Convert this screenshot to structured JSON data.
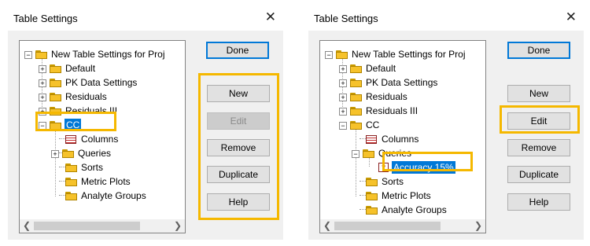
{
  "left": {
    "title": "Table Settings",
    "close_glyph": "✕",
    "tree": {
      "root": "New Table Settings for Proj",
      "default": "Default",
      "pk": "PK Data Settings",
      "residuals": "Residuals",
      "residuals3": "Residuals III",
      "cc": "CC",
      "columns": "Columns",
      "queries": "Queries",
      "sorts": "Sorts",
      "metric": "Metric Plots",
      "analyte": "Analyte Groups"
    },
    "buttons": {
      "done": "Done",
      "new": "New",
      "edit": "Edit",
      "remove": "Remove",
      "duplicate": "Duplicate",
      "help": "Help"
    }
  },
  "right": {
    "title": "Table Settings",
    "close_glyph": "✕",
    "tree": {
      "root": "New Table Settings for Proj",
      "default": "Default",
      "pk": "PK Data Settings",
      "residuals": "Residuals",
      "residuals3": "Residuals III",
      "cc": "CC",
      "columns": "Columns",
      "queries": "Queries",
      "accuracy": "Accuracy 15%",
      "sorts": "Sorts",
      "metric": "Metric Plots",
      "analyte": "Analyte Groups"
    },
    "buttons": {
      "done": "Done",
      "new": "New",
      "edit": "Edit",
      "remove": "Remove",
      "duplicate": "Duplicate",
      "help": "Help"
    }
  },
  "highlight_color": "#f5b800",
  "selection_color": "#0078d7",
  "icons": {
    "expanded": "minus-box",
    "collapsed": "plus-box",
    "folder": "folder-icon",
    "table": "table-icon",
    "query": "query-icon"
  }
}
